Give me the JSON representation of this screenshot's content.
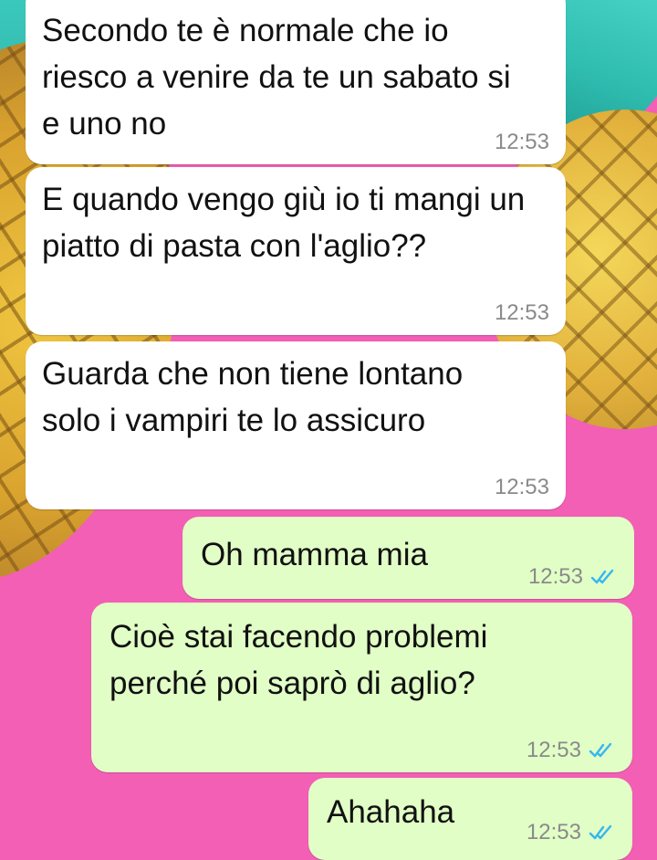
{
  "messages": [
    {
      "direction": "incoming",
      "text": "Secondo te è normale che io riesco a venire da te un sabato si e uno no",
      "time": "12:53"
    },
    {
      "direction": "incoming",
      "text": "E quando vengo giù io ti mangi un piatto di pasta con l'aglio??",
      "time": "12:53"
    },
    {
      "direction": "incoming",
      "text": "Guarda che non tiene lontano solo i vampiri te lo assicuro",
      "time": "12:53"
    },
    {
      "direction": "outgoing",
      "text": "Oh mamma mia",
      "time": "12:53",
      "status": "read-double-check-icon"
    },
    {
      "direction": "outgoing",
      "text": "Cioè stai facendo problemi perché poi saprò di aglio?",
      "time": "12:53",
      "status": "read-double-check-icon"
    },
    {
      "direction": "outgoing",
      "text": "Ahahaha",
      "time": "12:53",
      "status": "read-double-check-icon"
    }
  ],
  "colors": {
    "wallpaper": "#f25fb5",
    "incoming_bubble": "#ffffff",
    "outgoing_bubble": "#e1fec6",
    "read_check": "#34b7f1",
    "timestamp": "#8a8a8a"
  }
}
